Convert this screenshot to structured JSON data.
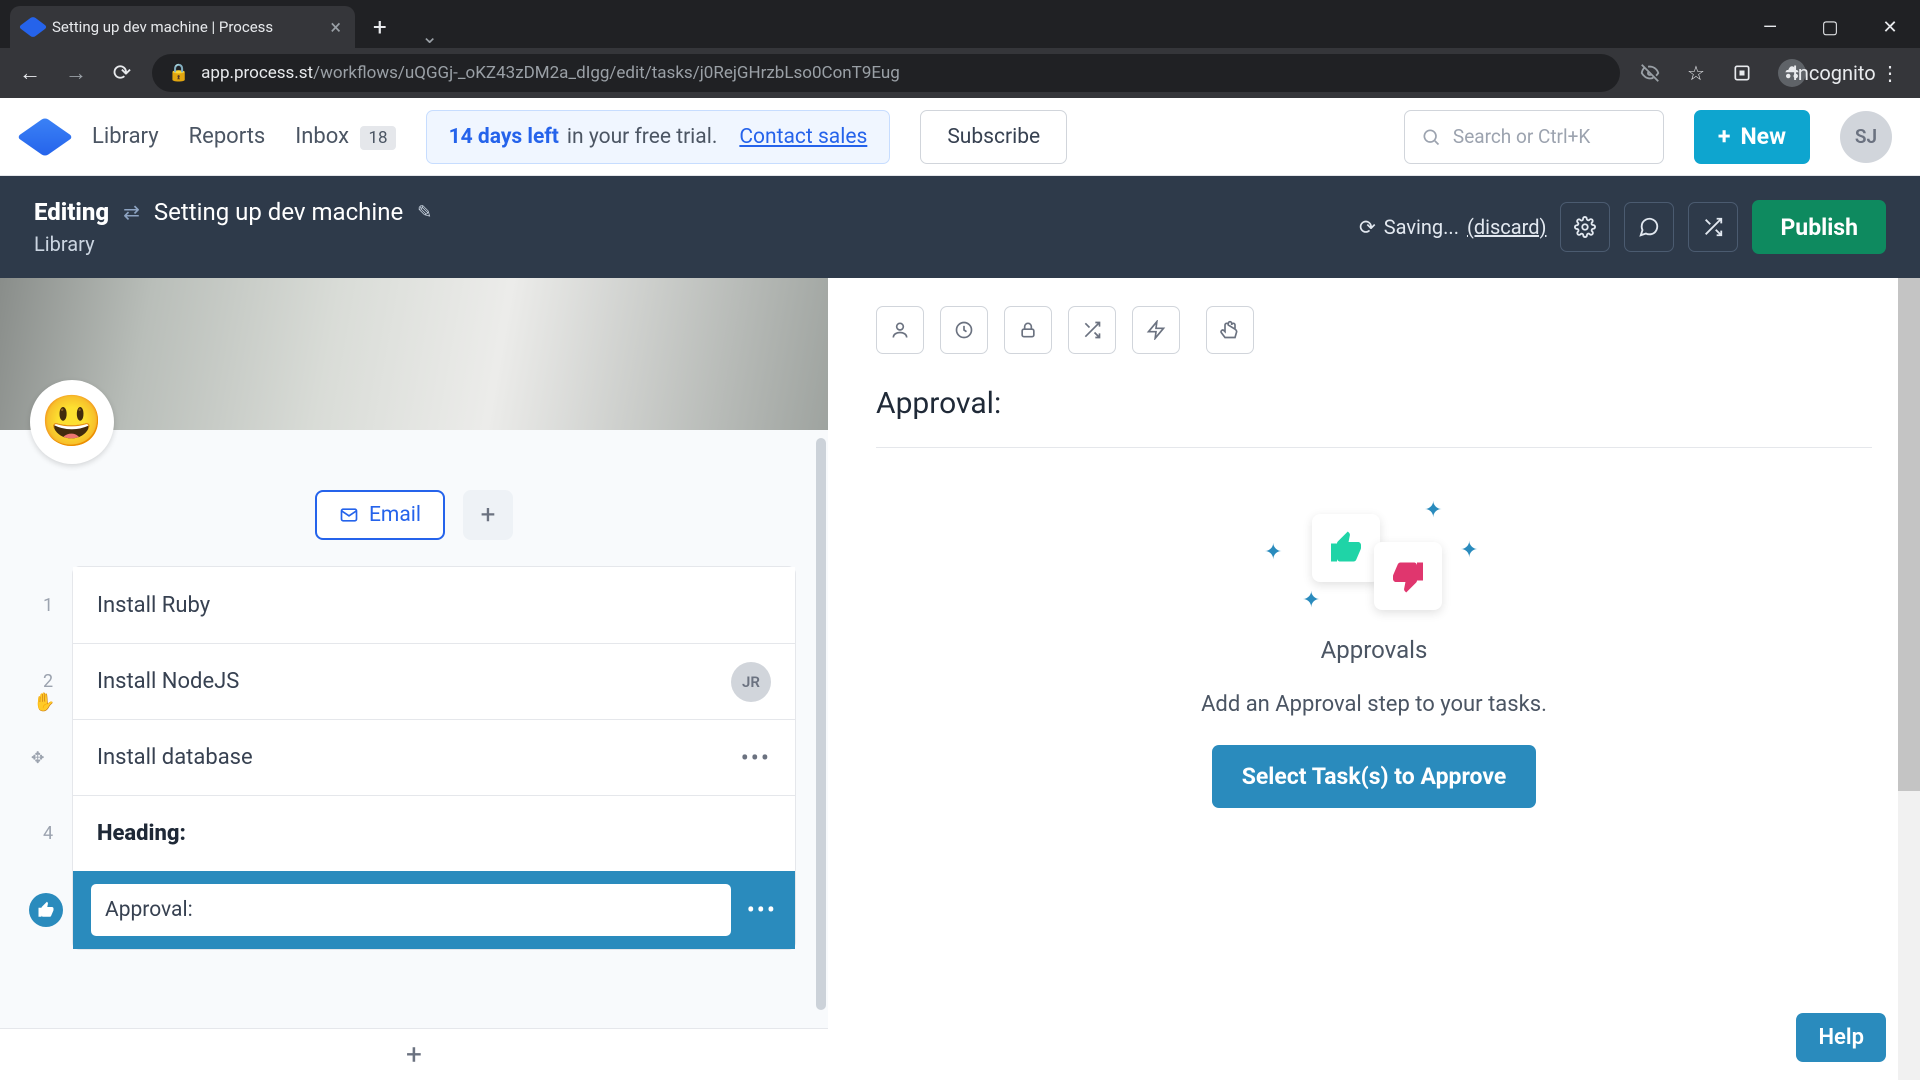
{
  "browser": {
    "tab_title": "Setting up dev machine | Process",
    "url_host": "app.process.st",
    "url_path": "/workflows/uQGGj-_oKZ43zDM2a_dIgg/edit/tasks/j0RejGHrzbLso0ConT9Eug",
    "incognito_label": "Incognito"
  },
  "header": {
    "nav": {
      "library": "Library",
      "reports": "Reports",
      "inbox": "Inbox",
      "inbox_count": "18"
    },
    "trial": {
      "days": "14 days left",
      "rest": " in your free trial.",
      "contact": "Contact sales"
    },
    "subscribe": "Subscribe",
    "search_placeholder": "Search or Ctrl+K",
    "new_btn": "New",
    "avatar_initials": "SJ"
  },
  "editbar": {
    "editing": "Editing",
    "workflow_name": "Setting up dev machine",
    "breadcrumb": "Library",
    "saving": "Saving...",
    "discard": "(discard)",
    "publish": "Publish"
  },
  "left": {
    "emoji": "😃",
    "email_btn": "Email",
    "tasks": [
      {
        "num": "1",
        "title": "Install Ruby"
      },
      {
        "num": "2",
        "title": "Install NodeJS",
        "avatar": "JR"
      },
      {
        "num": "",
        "title": "Install database",
        "has_more": true
      },
      {
        "num": "4",
        "title": "Heading:",
        "heading": true
      }
    ],
    "approval_input_value": "Approval: "
  },
  "right": {
    "heading": "Approval:",
    "approvals_title": "Approvals",
    "approvals_sub": "Add an Approval step to your tasks.",
    "select_btn": "Select Task(s) to Approve"
  },
  "help": "Help"
}
